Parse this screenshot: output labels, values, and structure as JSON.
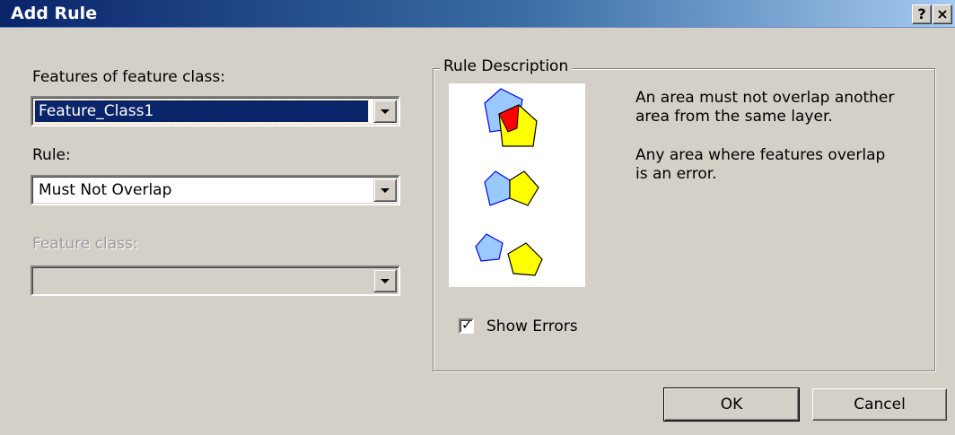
{
  "window": {
    "title": "Add Rule",
    "help_label": "?",
    "close_label": "×"
  },
  "features": {
    "label": "Features of feature class:",
    "value": "Feature_Class1"
  },
  "rule": {
    "label": "Rule:",
    "value": "Must Not Overlap"
  },
  "feature_class": {
    "label": "Feature class:",
    "value": ""
  },
  "rule_description": {
    "title": "Rule Description",
    "line1": "An area must not overlap another",
    "line2": "area from the same layer.",
    "line3": "Any area where features overlap",
    "line4": "is an error."
  },
  "show_errors": {
    "label": "Show Errors",
    "checked": true
  },
  "buttons": {
    "ok": "OK",
    "cancel": "Cancel"
  },
  "colors": {
    "polygon_blue": "#99c9ff",
    "polygon_yellow": "#ffff00",
    "overlap_red": "#ff0000",
    "outline_blue": "#0000ff"
  }
}
